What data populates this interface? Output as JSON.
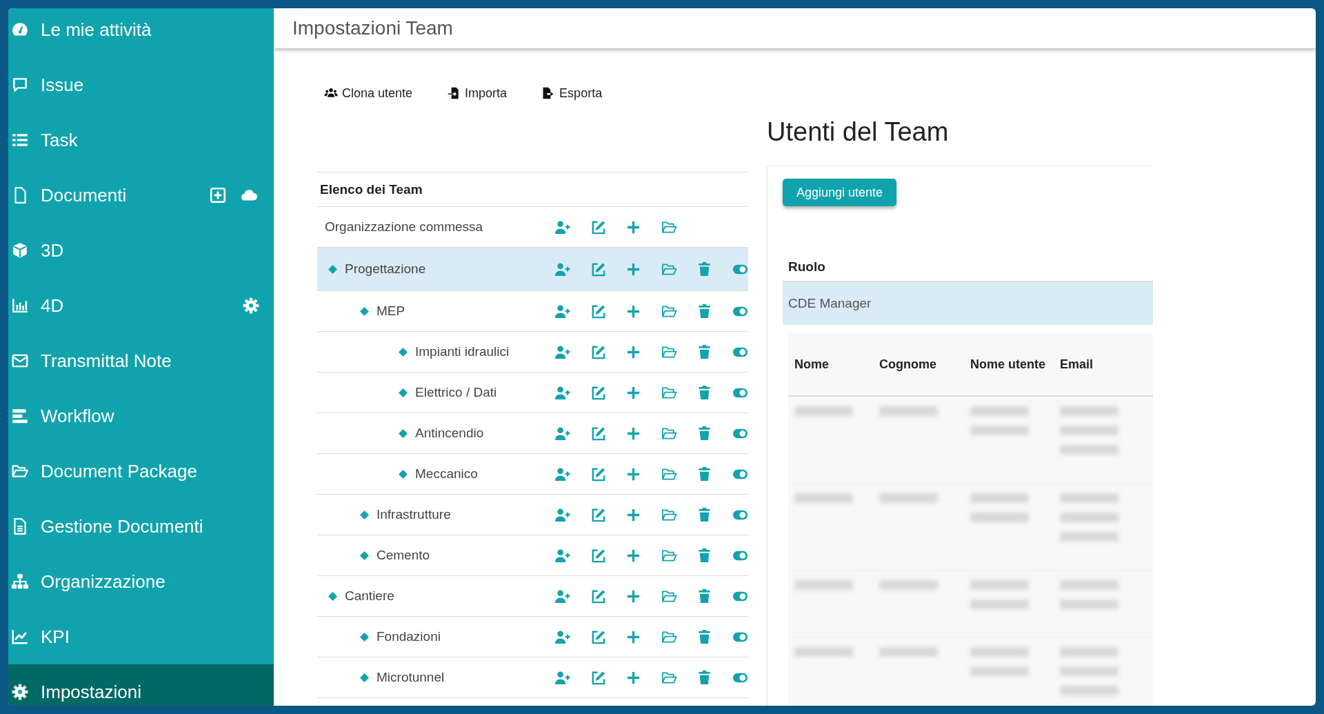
{
  "sidebar": {
    "items": [
      {
        "label": "Le mie attività",
        "kind": "dashboard",
        "selected": false
      },
      {
        "label": "Issue",
        "kind": "issue",
        "selected": false
      },
      {
        "label": "Task",
        "kind": "task",
        "selected": false
      },
      {
        "label": "Documenti",
        "kind": "documents",
        "selected": false
      },
      {
        "label": "3D",
        "kind": "model",
        "selected": false
      },
      {
        "label": "4D",
        "kind": "schedule",
        "selected": false
      },
      {
        "label": "Transmittal Note",
        "kind": "transmittal",
        "selected": false
      },
      {
        "label": "Workflow",
        "kind": "workflow",
        "selected": false
      },
      {
        "label": "Document Package",
        "kind": "package",
        "selected": false
      },
      {
        "label": "Gestione Documenti",
        "kind": "management",
        "selected": false
      },
      {
        "label": "Organizzazione",
        "kind": "organization",
        "selected": false
      },
      {
        "label": "KPI",
        "kind": "kpi",
        "selected": false
      },
      {
        "label": "Impostazioni",
        "kind": "settings",
        "selected": true
      }
    ]
  },
  "header": {
    "title": "Impostazioni Team"
  },
  "toolbar": [
    {
      "label": "Clona utente",
      "kind": "clone"
    },
    {
      "label": "Importa",
      "kind": "import"
    },
    {
      "label": "Esporta",
      "kind": "export"
    }
  ],
  "team_list": {
    "title": "Elenco dei Team",
    "items": [
      {
        "label": "Organizzazione commessa",
        "kind": "root",
        "selected": false,
        "children": [
          {
            "label": "Progettazione",
            "kind": "team",
            "selected": true,
            "children": [
              {
                "label": "MEP",
                "kind": "team",
                "selected": false,
                "children": [
                  {
                    "label": "Impianti idraulici",
                    "kind": "team",
                    "selected": false
                  },
                  {
                    "label": "Elettrico / Dati",
                    "kind": "team",
                    "selected": false
                  },
                  {
                    "label": "Antincendio",
                    "kind": "team",
                    "selected": false
                  },
                  {
                    "label": "Meccanico",
                    "kind": "team",
                    "selected": false
                  }
                ]
              },
              {
                "label": "Infrastrutture",
                "kind": "team",
                "selected": false
              },
              {
                "label": "Cemento",
                "kind": "team",
                "selected": false
              }
            ]
          },
          {
            "label": "Cantiere",
            "kind": "team",
            "selected": false,
            "children": [
              {
                "label": "Fondazioni",
                "kind": "team",
                "selected": false
              },
              {
                "label": "Microtunnel",
                "kind": "team",
                "selected": false
              }
            ]
          }
        ]
      }
    ]
  },
  "users_panel": {
    "title": "Utenti del Team",
    "add_button": "Aggiungi utente",
    "role_heading": "Ruolo",
    "roles": [
      {
        "label": "CDE Manager",
        "selected": true
      }
    ],
    "table": {
      "columns": [
        "Nome",
        "Cognome",
        "Nome utente",
        "Email"
      ],
      "rows": [
        {
          "kind": "tall"
        },
        {
          "kind": "tall"
        },
        {
          "kind": "short"
        },
        {
          "kind": "tall"
        }
      ]
    }
  }
}
